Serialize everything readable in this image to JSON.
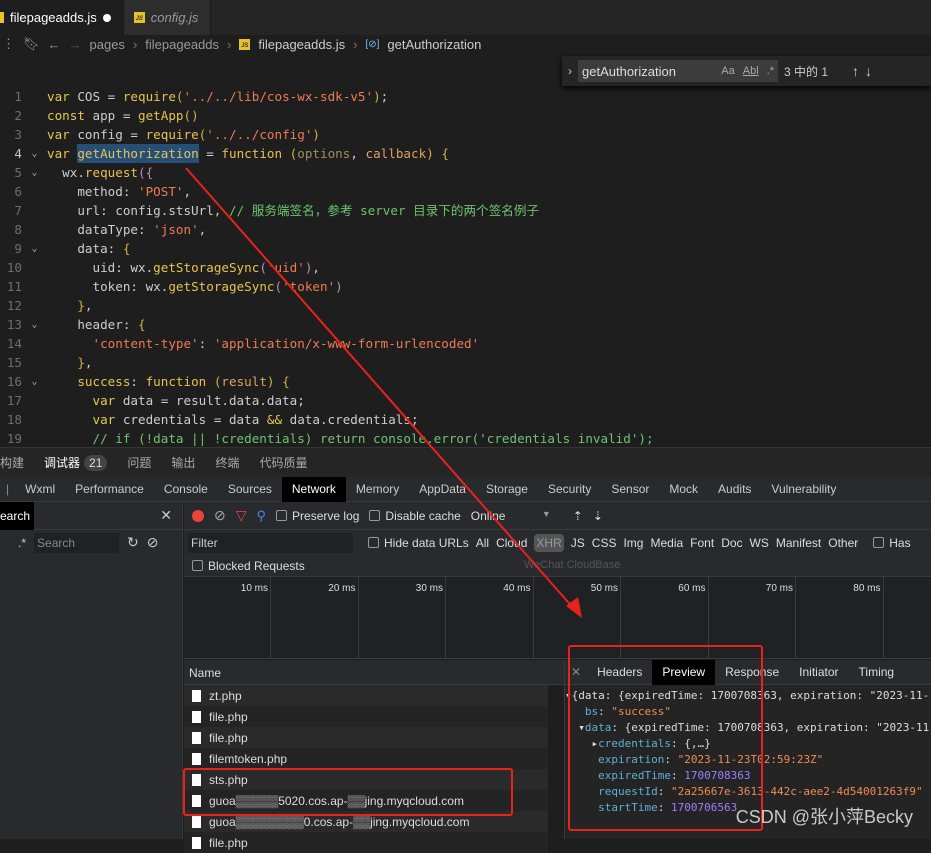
{
  "editor": {
    "tabs": [
      {
        "label": "filepageadds.js",
        "modified": true,
        "active": true
      },
      {
        "label": "config.js",
        "active": false
      }
    ],
    "breadcrumb": [
      "pages",
      "filepageadds",
      "filepageadds.js",
      "getAuthorization"
    ],
    "find": {
      "value": "getAuthorization",
      "match_case": "Aa",
      "whole_word": "Abl",
      "regex": ".*",
      "result": "3 中的 1"
    },
    "code": [
      {
        "n": "1",
        "t": [
          [
            "k",
            "var "
          ],
          [
            "i",
            "COS = "
          ],
          [
            "f",
            "require"
          ],
          [
            "b",
            "("
          ],
          [
            "s",
            "'../../lib/cos-wx-sdk-v5'"
          ],
          [
            "b",
            ")"
          ],
          [
            "i",
            ";"
          ]
        ]
      },
      {
        "n": "2",
        "t": [
          [
            "k",
            "const "
          ],
          [
            "i",
            "app = "
          ],
          [
            "f",
            "getApp"
          ],
          [
            "b",
            "()"
          ]
        ]
      },
      {
        "n": "3",
        "t": [
          [
            "k",
            "var "
          ],
          [
            "i",
            "config = "
          ],
          [
            "f",
            "require"
          ],
          [
            "b",
            "("
          ],
          [
            "s",
            "'../../config'"
          ],
          [
            "b",
            ")"
          ]
        ]
      },
      {
        "n": "4",
        "fold": true,
        "cur": true,
        "t": [
          [
            "k",
            "var "
          ],
          [
            "hl",
            "getAuthorization"
          ],
          [
            "i",
            " = "
          ],
          [
            "f",
            "function "
          ],
          [
            "b",
            "("
          ],
          [
            "p",
            "options"
          ],
          [
            "i",
            ", "
          ],
          [
            "pr",
            "callback"
          ],
          [
            "b",
            ") {"
          ]
        ]
      },
      {
        "n": "5",
        "fold": true,
        "t": [
          [
            "i",
            "  wx."
          ],
          [
            "f",
            "request"
          ],
          [
            "pu",
            "({"
          ]
        ]
      },
      {
        "n": "6",
        "t": [
          [
            "i",
            "    method: "
          ],
          [
            "s",
            "'POST'"
          ],
          [
            "i",
            ","
          ]
        ]
      },
      {
        "n": "7",
        "t": [
          [
            "i",
            "    url: config.stsUrl, "
          ],
          [
            "c",
            "// 服务端签名，参考 server 目录下的两个签名例子"
          ]
        ]
      },
      {
        "n": "8",
        "t": [
          [
            "i",
            "    dataType: "
          ],
          [
            "s",
            "'json'"
          ],
          [
            "i",
            ","
          ]
        ]
      },
      {
        "n": "9",
        "fold": true,
        "t": [
          [
            "i",
            "    data: "
          ],
          [
            "b",
            "{"
          ]
        ]
      },
      {
        "n": "10",
        "t": [
          [
            "i",
            "      uid: wx."
          ],
          [
            "f",
            "getStorageSync"
          ],
          [
            "pu",
            "("
          ],
          [
            "s",
            "'uid'"
          ],
          [
            "pu",
            ")"
          ],
          [
            "i",
            ","
          ]
        ]
      },
      {
        "n": "11",
        "t": [
          [
            "i",
            "      token: wx."
          ],
          [
            "f",
            "getStorageSync"
          ],
          [
            "pu",
            "("
          ],
          [
            "s",
            "'token'"
          ],
          [
            "pu",
            ")"
          ]
        ]
      },
      {
        "n": "12",
        "t": [
          [
            "b",
            "    }"
          ],
          [
            "i",
            ","
          ]
        ]
      },
      {
        "n": "13",
        "fold": true,
        "t": [
          [
            "i",
            "    header: "
          ],
          [
            "b",
            "{"
          ]
        ]
      },
      {
        "n": "14",
        "t": [
          [
            "s",
            "      'content-type'"
          ],
          [
            "i",
            ": "
          ],
          [
            "s",
            "'application/x-www-form-urlencoded'"
          ]
        ]
      },
      {
        "n": "15",
        "t": [
          [
            "b",
            "    }"
          ],
          [
            "i",
            ","
          ]
        ]
      },
      {
        "n": "16",
        "fold": true,
        "t": [
          [
            "f",
            "    success"
          ],
          [
            "i",
            ": "
          ],
          [
            "f",
            "function "
          ],
          [
            "b",
            "("
          ],
          [
            "pr",
            "result"
          ],
          [
            "b",
            ") {"
          ]
        ]
      },
      {
        "n": "17",
        "t": [
          [
            "k",
            "      var "
          ],
          [
            "i",
            "data = result.data.data;"
          ]
        ]
      },
      {
        "n": "18",
        "t": [
          [
            "k",
            "      var "
          ],
          [
            "i",
            "credentials = data "
          ],
          [
            "k",
            "&&"
          ],
          [
            "i",
            " data.credentials;"
          ]
        ]
      },
      {
        "n": "19",
        "t": [
          [
            "c",
            "      // if (!data || !credentials) return console.error('credentials invalid');"
          ]
        ]
      }
    ]
  },
  "panel_tabs": [
    {
      "label": "构建"
    },
    {
      "label": "调试器",
      "badge": "21",
      "active": true
    },
    {
      "label": "问题"
    },
    {
      "label": "输出"
    },
    {
      "label": "终端"
    },
    {
      "label": "代码质量"
    }
  ],
  "devtools_tabs": [
    "Wxml",
    "Performance",
    "Console",
    "Sources",
    "Network",
    "Memory",
    "AppData",
    "Storage",
    "Security",
    "Sensor",
    "Mock",
    "Audits",
    "Vulnerability"
  ],
  "devtools_active": "Network",
  "sidebar": {
    "title": "earch",
    "regex": ".*",
    "search_placeholder": "Search"
  },
  "toolbar": {
    "preserve_log": "Preserve log",
    "disable_cache": "Disable cache",
    "throttle": "Online"
  },
  "filter": {
    "placeholder": "Filter",
    "hide_data_urls": "Hide data URLs",
    "types": [
      "All",
      "Cloud",
      "XHR",
      "JS",
      "CSS",
      "Img",
      "Media",
      "Font",
      "Doc",
      "WS",
      "Manifest",
      "Other"
    ],
    "active_type": "XHR",
    "has": "Has",
    "tooltip": "WeChat CloudBase"
  },
  "blocked_requests": "Blocked Requests",
  "timeline_ticks": [
    "10 ms",
    "20 ms",
    "30 ms",
    "40 ms",
    "50 ms",
    "60 ms",
    "70 ms",
    "80 ms"
  ],
  "requests": {
    "header": "Name",
    "rows": [
      "zt.php",
      "file.php",
      "file.php",
      "filemtoken.php",
      "sts.php",
      "guoa▒▒▒▒▒5020.cos.ap-▒▒jing.myqcloud.com",
      "guoa▒▒▒▒▒▒▒▒0.cos.ap-▒▒jing.myqcloud.com",
      "file.php"
    ]
  },
  "preview": {
    "tabs": [
      "Headers",
      "Preview",
      "Response",
      "Initiator",
      "Timing"
    ],
    "active": "Preview",
    "lines": [
      [
        [
          "jw",
          "▾{data: {expiredTime: 1700708363, expiration: \"2023-11-"
        ]
      ],
      [
        [
          "jw",
          "   "
        ],
        [
          "jk",
          "bs"
        ],
        [
          "jw",
          ": "
        ],
        [
          "js",
          "\"success\""
        ]
      ],
      [
        [
          "jw",
          "  ▾"
        ],
        [
          "jk",
          "data"
        ],
        [
          "jw",
          ": {expiredTime: 1700708363, expiration: \"2023-11"
        ]
      ],
      [
        [
          "jw",
          "    ▸"
        ],
        [
          "jk",
          "credentials"
        ],
        [
          "jw",
          ": {,…}"
        ]
      ],
      [
        [
          "jw",
          "     "
        ],
        [
          "jk",
          "expiration"
        ],
        [
          "jw",
          ": "
        ],
        [
          "js",
          "\"2023-11-23T02:59:23Z\""
        ]
      ],
      [
        [
          "jw",
          "     "
        ],
        [
          "jk",
          "expiredTime"
        ],
        [
          "jw",
          ": "
        ],
        [
          "jn",
          "1700708363"
        ]
      ],
      [
        [
          "jw",
          "     "
        ],
        [
          "jk",
          "requestId"
        ],
        [
          "jw",
          ": "
        ],
        [
          "js",
          "\"2a25667e-3613-442c-aee2-4d54001263f9\""
        ]
      ],
      [
        [
          "jw",
          "     "
        ],
        [
          "jk",
          "startTime"
        ],
        [
          "jw",
          ": "
        ],
        [
          "jn",
          "1700706563"
        ]
      ]
    ]
  },
  "watermark": "CSDN @张小萍Becky",
  "colors": {
    "annotation": "#e8231b",
    "record": "#e8443a",
    "filter_icon": "#e8443a",
    "search_icon": "#3c8ce7"
  }
}
